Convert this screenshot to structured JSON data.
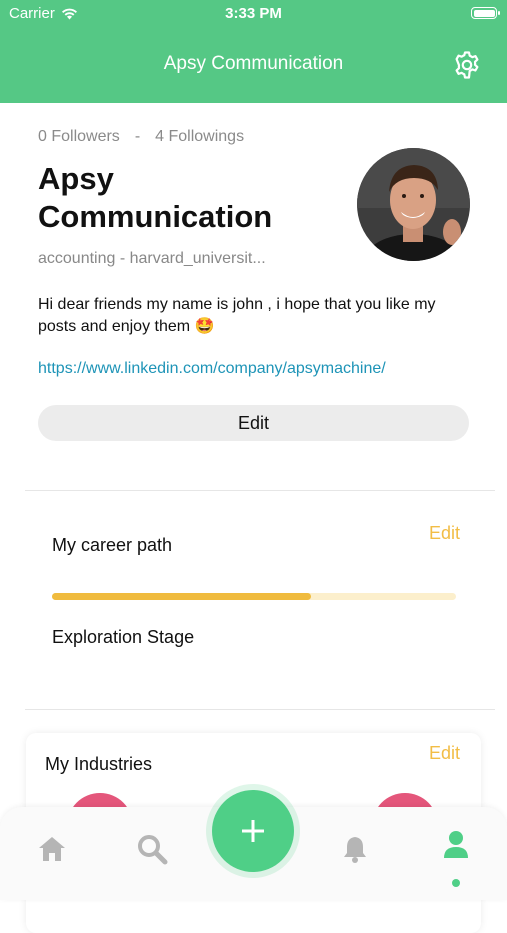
{
  "status_bar": {
    "carrier": "Carrier",
    "time": "3:33 PM"
  },
  "header": {
    "title": "Apsy Communication",
    "settings_icon": "gear-icon"
  },
  "profile": {
    "followers": "0 Followers",
    "separator": "-",
    "followings": "4 Followings",
    "name": "Apsy Communication",
    "subtitle": "accounting - harvard_universit...",
    "bio": "Hi dear friends my name is john , i hope that you like my posts and enjoy them 🤩",
    "link": "https://www.linkedin.com/company/apsymachine/",
    "edit_label": "Edit"
  },
  "career": {
    "title": "My career path",
    "edit_label": "Edit",
    "progress_fraction": 0.64,
    "stage": "Exploration Stage"
  },
  "industries": {
    "title": "My Industries",
    "edit_label": "Edit"
  },
  "tabbar": {
    "items": [
      "home-icon",
      "search-icon",
      "add-icon",
      "bell-icon",
      "profile-icon"
    ],
    "active": "profile-icon"
  },
  "colors": {
    "brand_green": "#55c885",
    "accent_yellow": "#f0bb3e",
    "link_blue": "#1e94b7",
    "pink": "#e4567b"
  }
}
